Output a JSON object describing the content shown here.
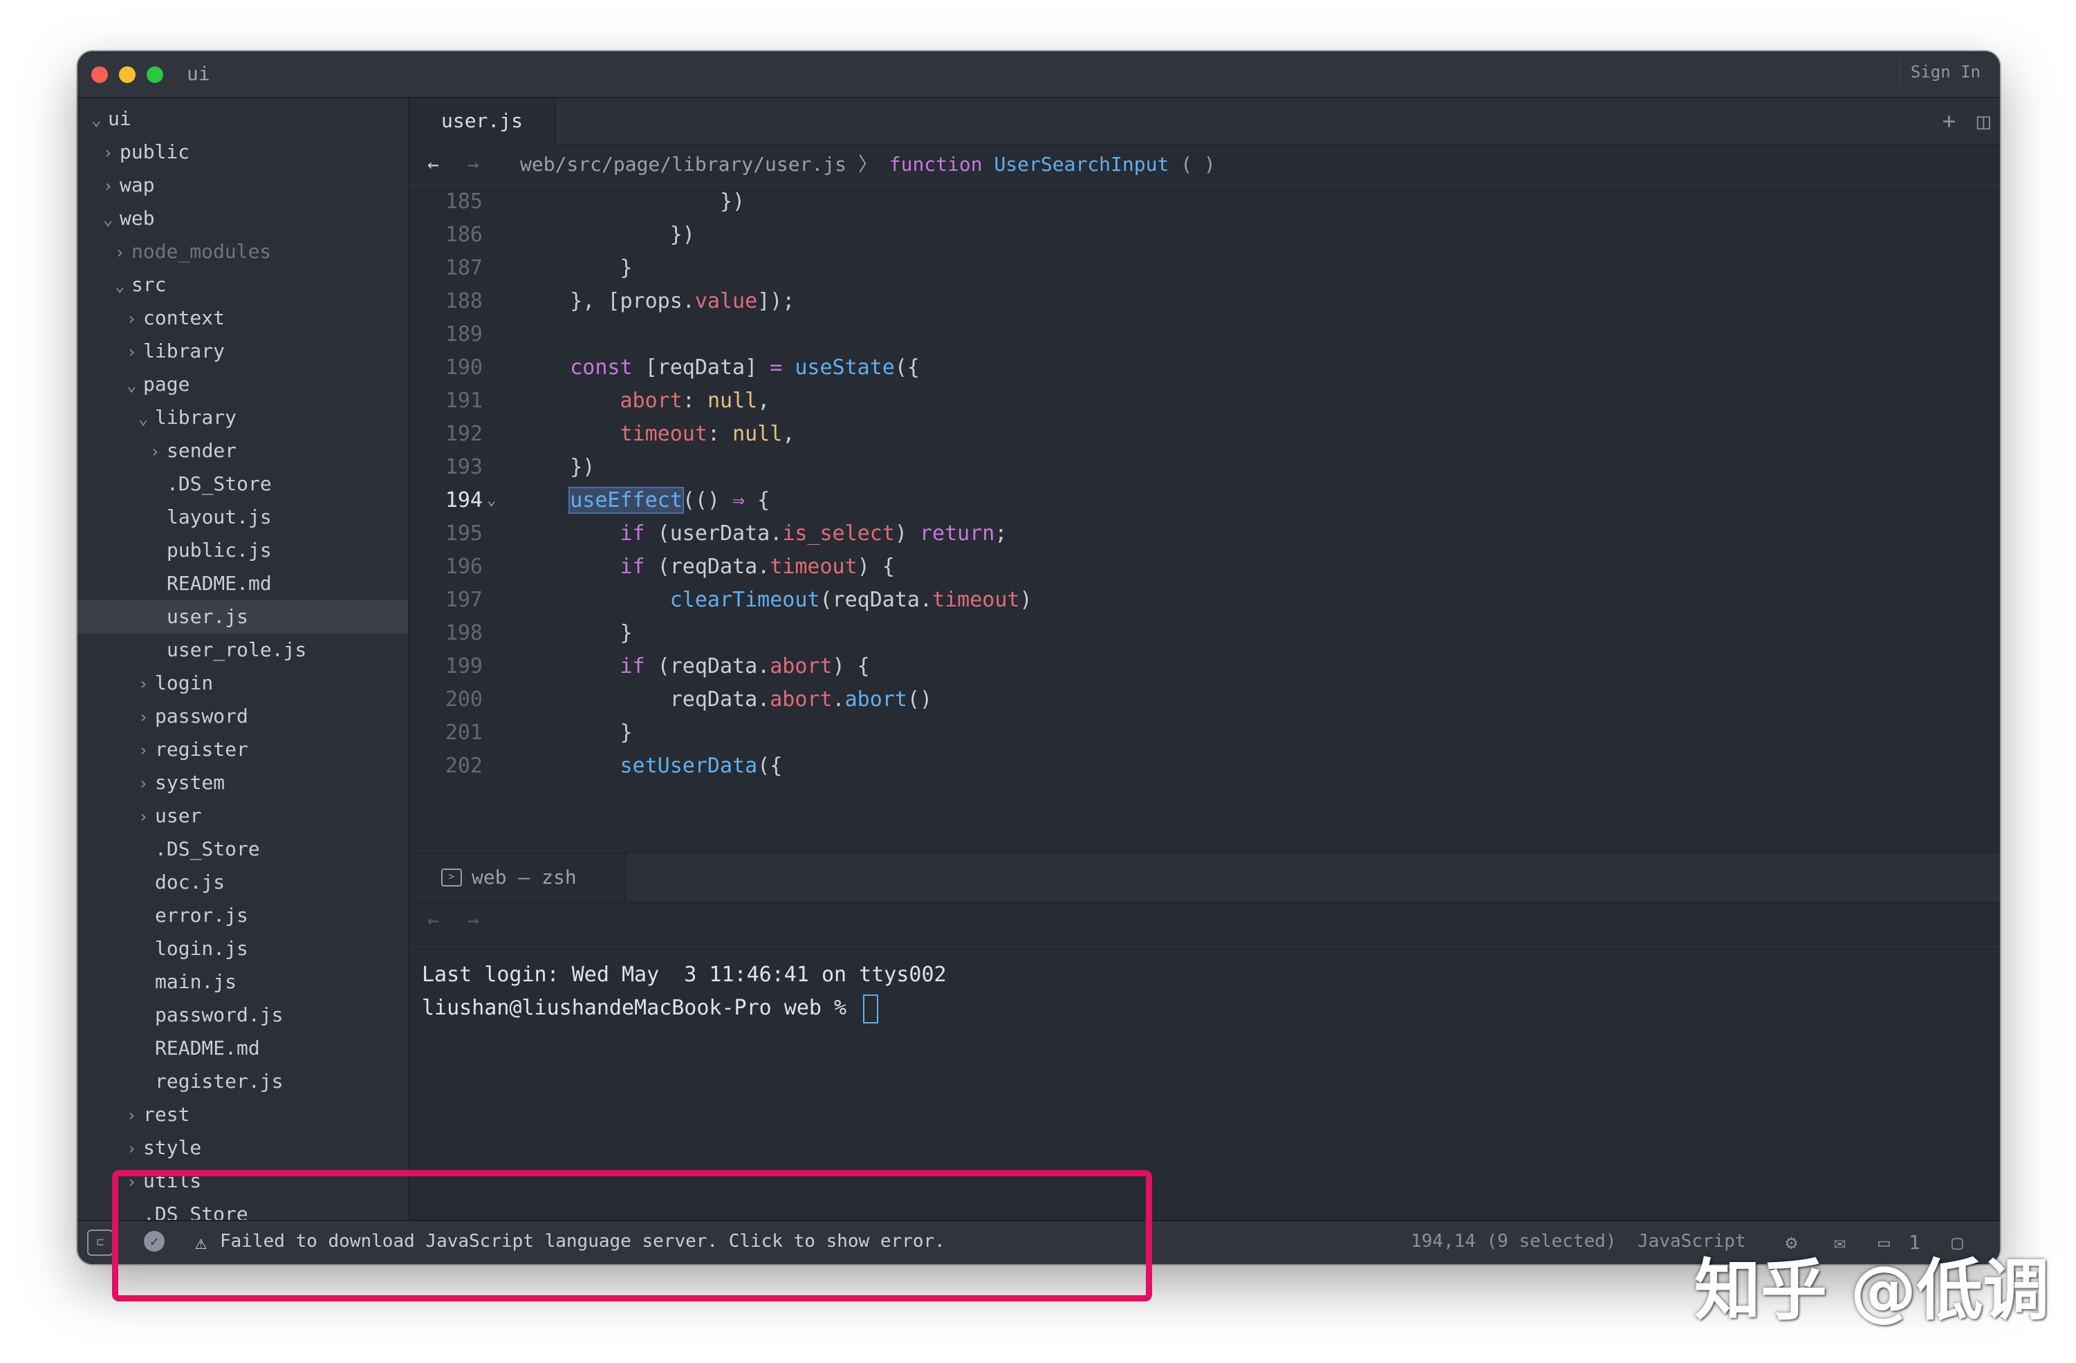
{
  "window": {
    "title": "ui",
    "sign_in": "Sign In"
  },
  "sidebar": {
    "items": [
      {
        "chev": "⌄",
        "label": "ui",
        "depth": 0
      },
      {
        "chev": "›",
        "label": "public",
        "depth": 1
      },
      {
        "chev": "›",
        "label": "wap",
        "depth": 1
      },
      {
        "chev": "⌄",
        "label": "web",
        "depth": 1
      },
      {
        "chev": "›",
        "label": "node_modules",
        "depth": 2,
        "dim": true
      },
      {
        "chev": "⌄",
        "label": "src",
        "depth": 2
      },
      {
        "chev": "›",
        "label": "context",
        "depth": 3
      },
      {
        "chev": "›",
        "label": "library",
        "depth": 3
      },
      {
        "chev": "⌄",
        "label": "page",
        "depth": 3
      },
      {
        "chev": "⌄",
        "label": "library",
        "depth": 4
      },
      {
        "chev": "›",
        "label": "sender",
        "depth": 5
      },
      {
        "chev": "",
        "label": ".DS_Store",
        "depth": 5
      },
      {
        "chev": "",
        "label": "layout.js",
        "depth": 5
      },
      {
        "chev": "",
        "label": "public.js",
        "depth": 5
      },
      {
        "chev": "",
        "label": "README.md",
        "depth": 5
      },
      {
        "chev": "",
        "label": "user.js",
        "depth": 5,
        "active": true
      },
      {
        "chev": "",
        "label": "user_role.js",
        "depth": 5
      },
      {
        "chev": "›",
        "label": "login",
        "depth": 4
      },
      {
        "chev": "›",
        "label": "password",
        "depth": 4
      },
      {
        "chev": "›",
        "label": "register",
        "depth": 4
      },
      {
        "chev": "›",
        "label": "system",
        "depth": 4
      },
      {
        "chev": "›",
        "label": "user",
        "depth": 4
      },
      {
        "chev": "",
        "label": ".DS_Store",
        "depth": 4
      },
      {
        "chev": "",
        "label": "doc.js",
        "depth": 4
      },
      {
        "chev": "",
        "label": "error.js",
        "depth": 4
      },
      {
        "chev": "",
        "label": "login.js",
        "depth": 4
      },
      {
        "chev": "",
        "label": "main.js",
        "depth": 4
      },
      {
        "chev": "",
        "label": "password.js",
        "depth": 4
      },
      {
        "chev": "",
        "label": "README.md",
        "depth": 4
      },
      {
        "chev": "",
        "label": "register.js",
        "depth": 4
      },
      {
        "chev": "›",
        "label": "rest",
        "depth": 3
      },
      {
        "chev": "›",
        "label": "style",
        "depth": 3
      },
      {
        "chev": "›",
        "label": "utils",
        "depth": 3
      },
      {
        "chev": "",
        "label": ".DS_Store",
        "depth": 3
      }
    ]
  },
  "editor": {
    "tab_label": "user.js",
    "tab_actions": {
      "new": "+",
      "split": "◫"
    },
    "breadcrumb": {
      "back": "←",
      "forward": "→",
      "path": "web/src/page/library/user.js 〉",
      "kw": "function",
      "fn": "UserSearchInput",
      "tail": "( )"
    },
    "lines": [
      {
        "n": "185",
        "t": [
          [
            "",
            "                })"
          ]
        ]
      },
      {
        "n": "186",
        "t": [
          [
            "",
            "            })"
          ]
        ]
      },
      {
        "n": "187",
        "t": [
          [
            "",
            "        }"
          ]
        ]
      },
      {
        "n": "188",
        "t": [
          [
            "",
            "    }, [props."
          ],
          [
            "prop",
            "value"
          ],
          [
            "",
            "]);"
          ]
        ]
      },
      {
        "n": "189",
        "t": [
          [
            "",
            ""
          ]
        ]
      },
      {
        "n": "190",
        "t": [
          [
            "",
            "    "
          ],
          [
            "kw",
            "const"
          ],
          [
            "",
            " [reqData] "
          ],
          [
            "kw",
            "="
          ],
          [
            "",
            " "
          ],
          [
            "fn",
            "useState"
          ],
          [
            "",
            "({"
          ]
        ]
      },
      {
        "n": "191",
        "t": [
          [
            "",
            "        "
          ],
          [
            "prop",
            "abort"
          ],
          [
            "",
            ": "
          ],
          [
            "num",
            "null"
          ],
          [
            "",
            ","
          ]
        ]
      },
      {
        "n": "192",
        "t": [
          [
            "",
            "        "
          ],
          [
            "prop",
            "timeout"
          ],
          [
            "",
            ": "
          ],
          [
            "num",
            "null"
          ],
          [
            "",
            ","
          ]
        ]
      },
      {
        "n": "193",
        "t": [
          [
            "",
            "    })"
          ]
        ]
      },
      {
        "n": "194",
        "cur": true,
        "fold": "⌄",
        "t": [
          [
            "",
            "    "
          ],
          [
            "fn sel",
            "useEffect"
          ],
          [
            "",
            "(() "
          ],
          [
            "kw",
            "⇒"
          ],
          [
            "",
            " {"
          ]
        ]
      },
      {
        "n": "195",
        "t": [
          [
            "",
            "        "
          ],
          [
            "kw",
            "if"
          ],
          [
            "",
            " (userData."
          ],
          [
            "prop",
            "is_select"
          ],
          [
            "",
            ") "
          ],
          [
            "kw",
            "return"
          ],
          [
            "",
            ";"
          ]
        ]
      },
      {
        "n": "196",
        "t": [
          [
            "",
            "        "
          ],
          [
            "kw",
            "if"
          ],
          [
            "",
            " (reqData."
          ],
          [
            "prop",
            "timeout"
          ],
          [
            "",
            ") {"
          ]
        ]
      },
      {
        "n": "197",
        "t": [
          [
            "",
            "            "
          ],
          [
            "fn",
            "clearTimeout"
          ],
          [
            "",
            "(reqData."
          ],
          [
            "prop",
            "timeout"
          ],
          [
            "",
            ")"
          ]
        ]
      },
      {
        "n": "198",
        "t": [
          [
            "",
            "        }"
          ]
        ]
      },
      {
        "n": "199",
        "t": [
          [
            "",
            "        "
          ],
          [
            "kw",
            "if"
          ],
          [
            "",
            " (reqData."
          ],
          [
            "prop",
            "abort"
          ],
          [
            "",
            ") {"
          ]
        ]
      },
      {
        "n": "200",
        "t": [
          [
            "",
            "            reqData."
          ],
          [
            "prop",
            "abort"
          ],
          [
            "",
            "."
          ],
          [
            "fn",
            "abort"
          ],
          [
            "",
            "()"
          ]
        ]
      },
      {
        "n": "201",
        "t": [
          [
            "",
            "        }"
          ]
        ]
      },
      {
        "n": "202",
        "t": [
          [
            "",
            "        "
          ],
          [
            "fn",
            "setUserData"
          ],
          [
            "",
            "({"
          ]
        ]
      }
    ]
  },
  "terminal": {
    "tab_label": "web — zsh",
    "nav_back": "←",
    "nav_forward": "→",
    "line1": "Last login: Wed May  3 11:46:41 on ttys002",
    "line2": "liushan@liushandeMacBook-Pro web % "
  },
  "status": {
    "message": "Failed to download JavaScript language server. Click to show error.",
    "position": "194,14 (9 selected)",
    "language": "JavaScript",
    "term_count": "1"
  },
  "watermark": "知乎 @低调",
  "colors": {
    "window_bg": "#272b33",
    "keyword": "#c678dd",
    "function": "#61afef",
    "property": "#e06c75",
    "literal": "#e5c07b",
    "highlight_box": "#e0115f"
  }
}
